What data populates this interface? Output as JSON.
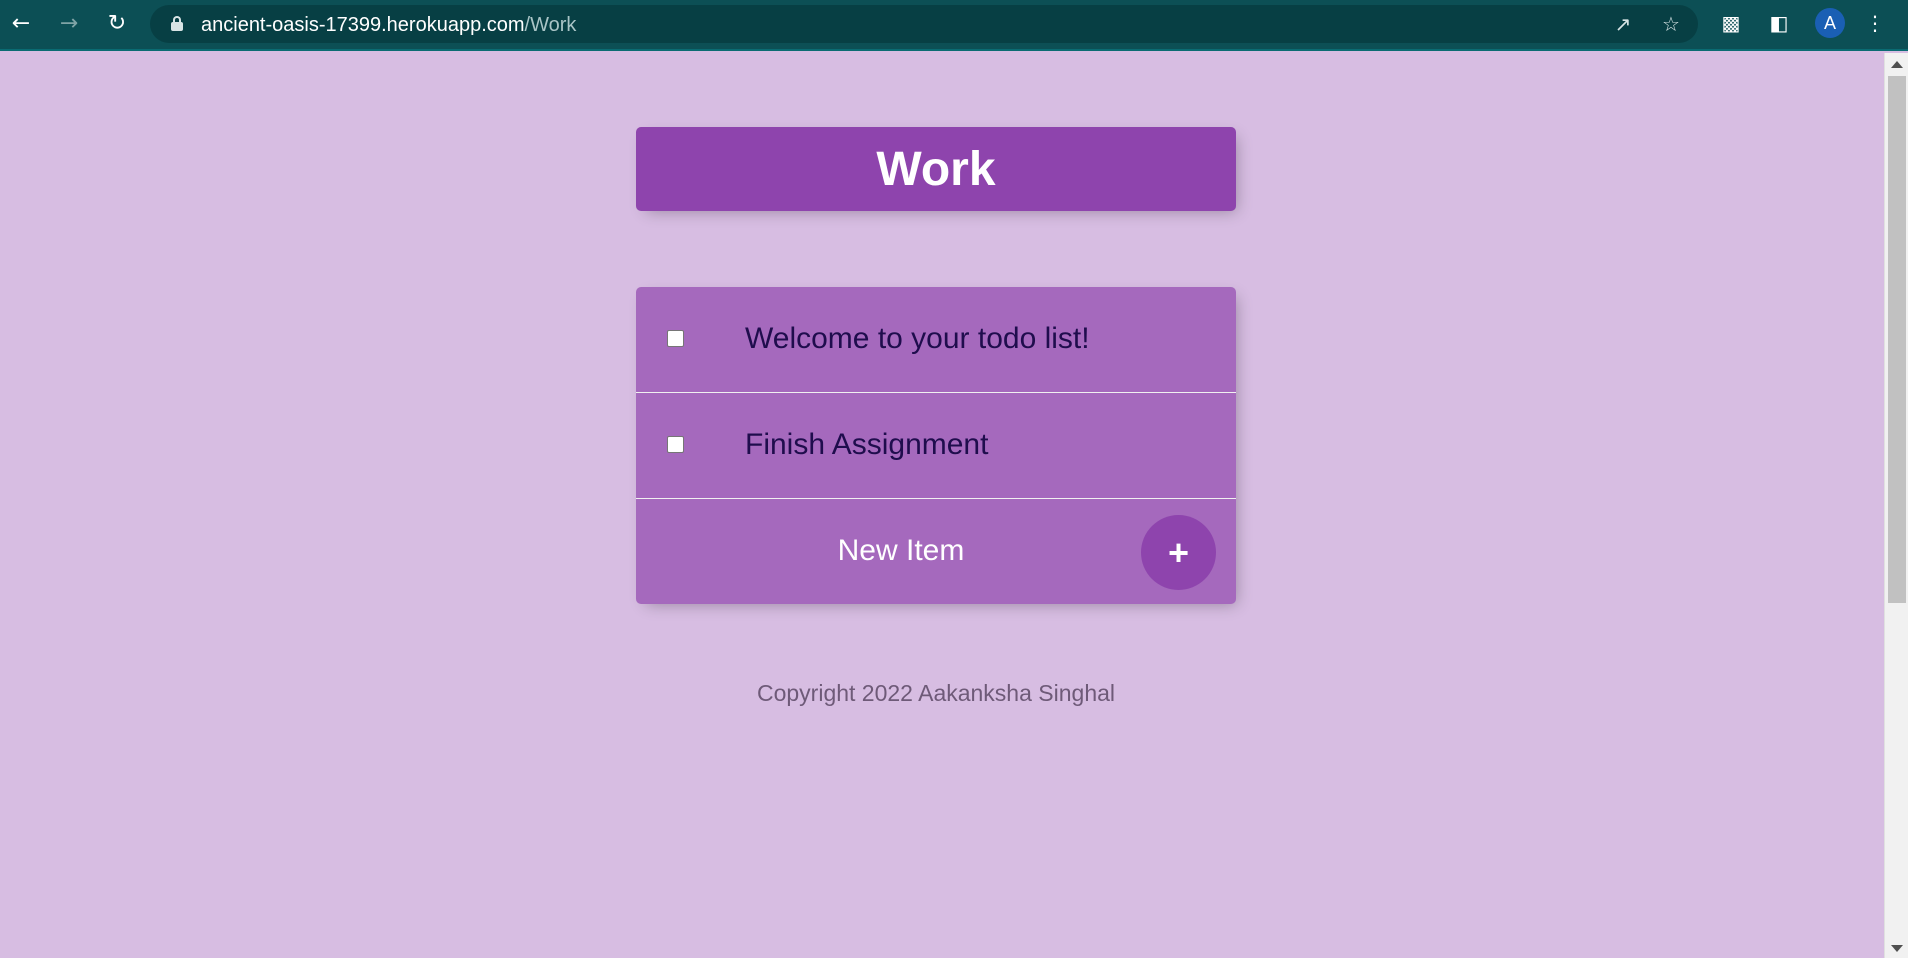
{
  "browser": {
    "url_host": "ancient-oasis-17399.herokuapp.com",
    "url_path": "/Work",
    "avatar_letter": "A"
  },
  "page": {
    "title": "Work",
    "items": [
      {
        "label": "Welcome to your todo list!",
        "checked": false
      },
      {
        "label": "Finish Assignment",
        "checked": false
      }
    ],
    "new_item_placeholder": "New Item",
    "add_button_label": "+",
    "footer": "Copyright 2022 Aakanksha Singhal"
  },
  "colors": {
    "background": "#d7bde2",
    "header": "#8e44ad",
    "list": "#a569bd",
    "chrome": "#0c4f55"
  }
}
